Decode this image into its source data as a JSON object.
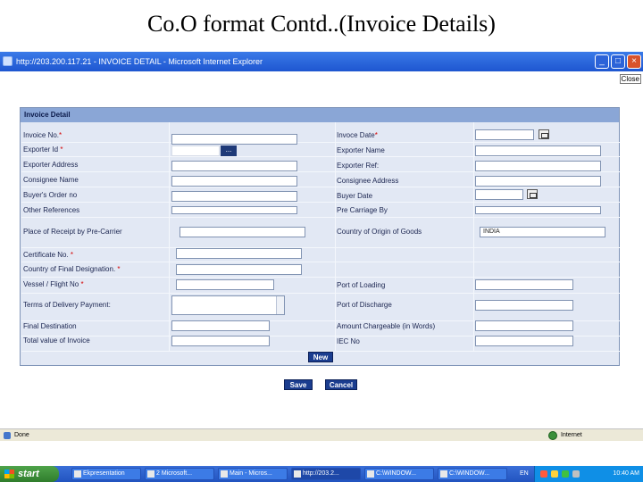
{
  "slide": {
    "title": "Co.O format Contd..(Invoice Details)"
  },
  "window": {
    "title": "http://203.200.117.21 - INVOICE DETAIL - Microsoft Internet Explorer"
  },
  "page": {
    "close_link": "Close"
  },
  "form": {
    "header": "Invoice Detail",
    "invoice_no_label": "Invoice No.",
    "invoice_date_label": "Invoce Date",
    "exporter_id_label": "Exporter Id ",
    "exporter_id_button": "...",
    "exporter_name_label": "Exporter Name",
    "exporter_address_label": "Exporter Address",
    "exporter_ref_label": "Exporter Ref:",
    "consignee_name_label": " Consignee Name",
    "consignee_address_label": "Consignee Address",
    "buyers_order_label": "Buyer's Order no",
    "buyer_date_label": "Buyer Date",
    "other_references_label": "Other References",
    "pre_carriage_label": "Pre Carriage By",
    "place_of_receipt_label": "Place of Receipt by Pre-Carrier",
    "country_of_origin_label": "Country of Origin of Goods",
    "country_of_origin_value": "INDIA",
    "certificate_no_label": "Certificate No. ",
    "country_final_destination_label": "Country of Final Designation. ",
    "vessel_flight_label": "Vessel / Flight No  ",
    "port_of_loading_label": "Port of Loading",
    "terms_delivery_label": "Terms of Delivery Payment:",
    "port_of_discharge_label": "Port of Discharge",
    "final_destination_label": "Final Destination",
    "amount_chargeable_label": "Amount Chargeable (in Words)",
    "total_value_label": "Total value of Invoice",
    "iec_no_label": "IEC No",
    "required_mark": "*",
    "new_button": "New",
    "save_button": "Save",
    "cancel_button": "Cancel"
  },
  "statusbar": {
    "left": "Done",
    "zone": "Internet"
  },
  "taskbar": {
    "start": "start",
    "items": [
      "Ekpresentation",
      "2 Microsoft...",
      "Main - Micros...",
      "http://203.2...",
      "C:\\WINDOW...",
      "C:\\WINDOW..."
    ],
    "lang": "EN",
    "time": "10:40 AM"
  },
  "colors": {
    "panel": "#e2e8f4",
    "header": "#8aa6d6",
    "button": "#1b3d8f",
    "titlebar": "#1e56d0"
  }
}
